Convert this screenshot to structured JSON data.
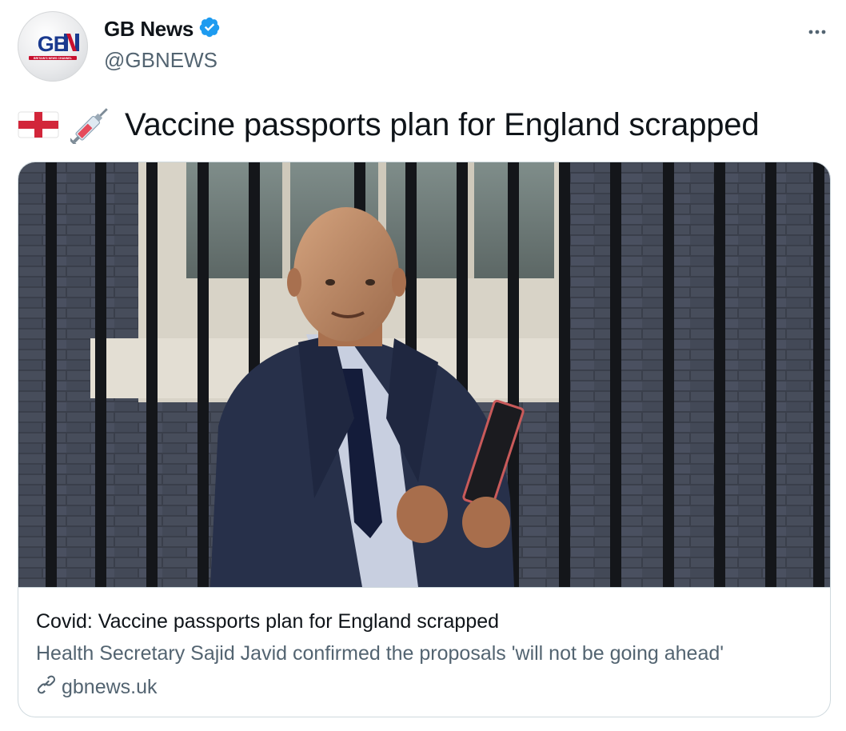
{
  "account": {
    "display_name": "GB News",
    "handle": "@GBNEWS",
    "verified": true,
    "avatar_logo_text": "GBN",
    "avatar_tagline": "BRITAIN'S NEWS CHANNEL"
  },
  "tweet": {
    "emojis": [
      "england-flag",
      "syringe"
    ],
    "text": "Vaccine passports plan for England scrapped"
  },
  "card": {
    "image_icon": "photo-man-suit-railings",
    "title": "Covid: Vaccine passports plan for England scrapped",
    "description": "Health Secretary Sajid Javid confirmed the proposals 'will not be going ahead'",
    "domain": "gbnews.uk",
    "domain_icon": "link-icon"
  },
  "colors": {
    "verified_badge": "#1d9bf0",
    "secondary_text": "#536471",
    "brand_red": "#c8102e",
    "brand_blue": "#1a3a8f"
  }
}
